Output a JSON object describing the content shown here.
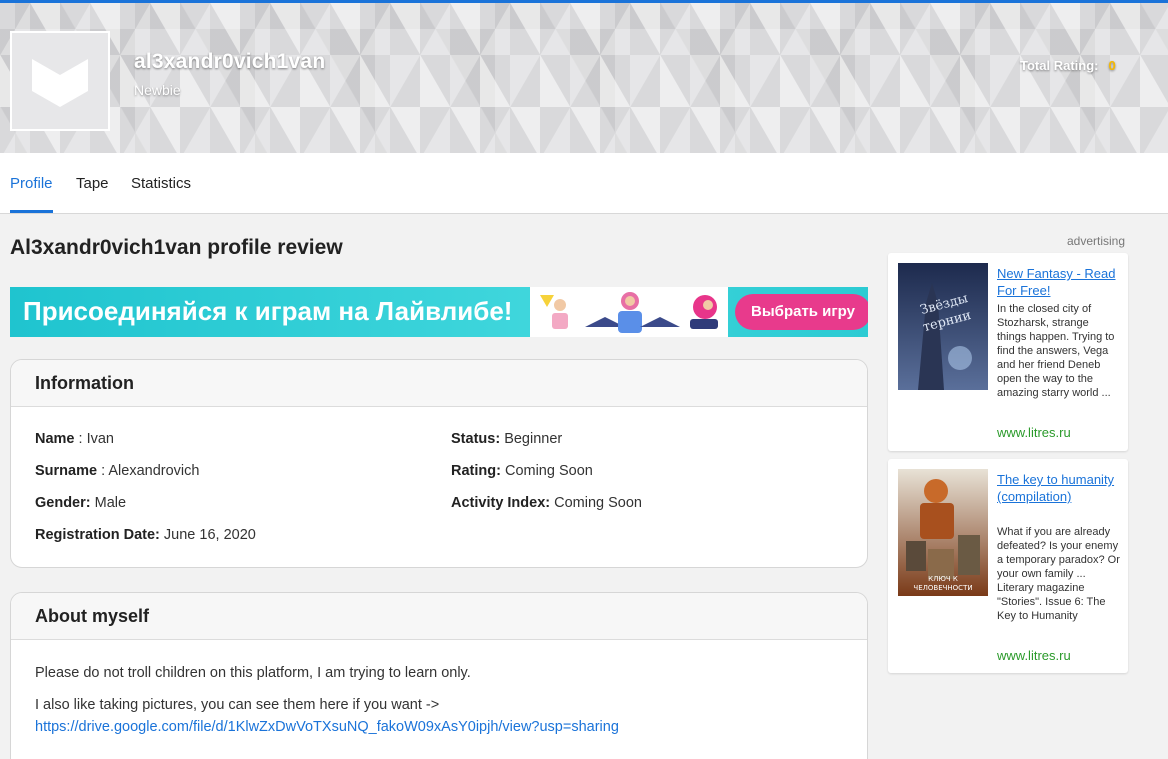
{
  "header": {
    "username": "al3xandr0vich1van",
    "rank": "Newbie",
    "total_rating_label": "Total Rating:",
    "total_rating_value": "0"
  },
  "tabs": [
    {
      "label": "Profile",
      "active": true
    },
    {
      "label": "Tape",
      "active": false
    },
    {
      "label": "Statistics",
      "active": false
    }
  ],
  "main": {
    "title": "Al3xandr0vich1van profile review",
    "ad_banner": {
      "text": "Присоединяйся к играм на Лайвлибе!",
      "cta": "Выбрать игру"
    },
    "information": {
      "heading": "Information",
      "left": [
        {
          "label": "Name",
          "sep": " : ",
          "value": "Ivan"
        },
        {
          "label": "Surname",
          "sep": " : ",
          "value": "Alexandrovich"
        },
        {
          "label": "Gender:",
          "sep": " ",
          "value": "Male"
        },
        {
          "label": "Registration Date:",
          "sep": " ",
          "value": "June 16, 2020"
        }
      ],
      "right": [
        {
          "label": "Status:",
          "sep": " ",
          "value": "Beginner"
        },
        {
          "label": "Rating:",
          "sep": " ",
          "value": "Coming Soon"
        },
        {
          "label": "Activity Index:",
          "sep": " ",
          "value": "Coming Soon"
        }
      ]
    },
    "about": {
      "heading": "About myself",
      "line1": "Please do not troll children on this platform, I am trying to learn only.",
      "line2": "I also like taking pictures, you can see them here if you want ->",
      "link": "https://drive.google.com/file/d/1KlwZxDwVoTXsuNQ_fakoW09xAsY0ipjh/view?usp=sharing"
    }
  },
  "sidebar": {
    "ad_label": "advertising",
    "items": [
      {
        "title": "New Fantasy - Read For Free!",
        "description": "In the closed city of Stozharsk, strange things happen. Trying to find the answers, Vega and her friend Deneb open the way to the amazing starry world ...",
        "source": "www.litres.ru",
        "cover_text": "Звёзды и тернии",
        "cover_color": "#2e3a63"
      },
      {
        "title": "The key to humanity (compilation)",
        "description": "What if you are already defeated? Is your enemy a temporary paradox? Or your own family ... Literary magazine \"Stories\". Issue 6: The Key to Humanity",
        "source": "www.litres.ru",
        "cover_text": "Ключ к человечности",
        "cover_color": "#b4501e"
      }
    ]
  },
  "colors": {
    "accent": "#1a73d9",
    "rating": "#f5b800",
    "source_link": "#2a9a2a",
    "cta": "#e83a8c"
  }
}
